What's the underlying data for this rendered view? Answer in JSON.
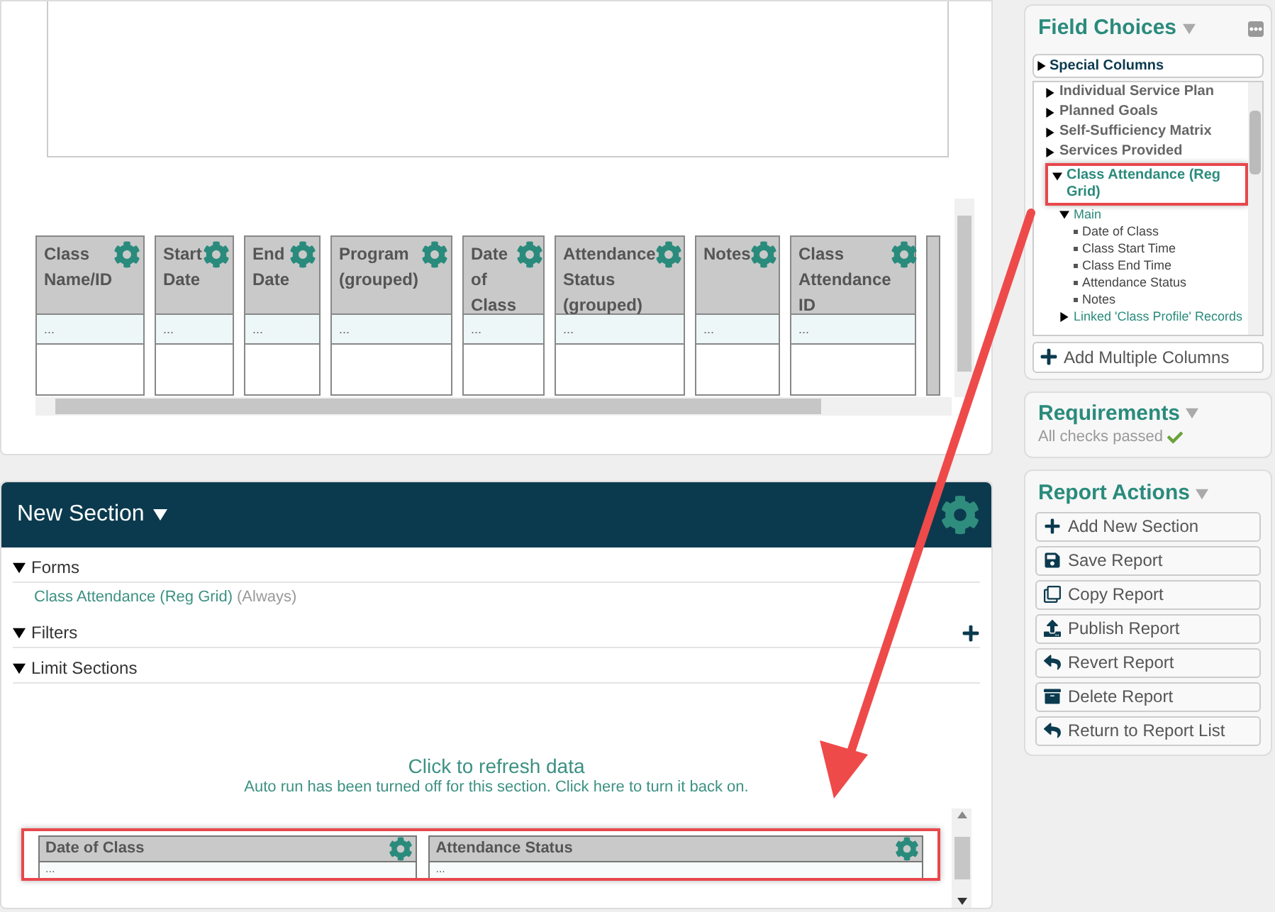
{
  "grid": {
    "columns": [
      {
        "label": "Class Name/ID",
        "cell": "..."
      },
      {
        "label": "Start Date",
        "cell": "..."
      },
      {
        "label": "End Date",
        "cell": "..."
      },
      {
        "label": "Program (grouped)",
        "cell": "..."
      },
      {
        "label": "Date of Class",
        "cell": "..."
      },
      {
        "label": "Attendance Status (grouped)",
        "cell": "..."
      },
      {
        "label": "Notes",
        "cell": "..."
      },
      {
        "label": "Class Attendance ID",
        "cell": "..."
      }
    ]
  },
  "section": {
    "title": "New Section",
    "groups": [
      {
        "label": "Forms",
        "expanded": true,
        "form": {
          "name": "Class Attendance (Reg Grid)",
          "condition": "(Always)"
        }
      },
      {
        "label": "Filters",
        "expanded": true,
        "add": true
      },
      {
        "label": "Limit Sections",
        "expanded": true
      }
    ],
    "refresh": {
      "title": "Click to refresh data",
      "note": "Auto run has been turned off for this section. Click here to turn it back on."
    },
    "columns": [
      {
        "label": "Date of Class",
        "cell": "..."
      },
      {
        "label": "Attendance Status",
        "cell": "..."
      }
    ]
  },
  "field_choices": {
    "title": "Field Choices",
    "special_columns": {
      "label": "Special Columns",
      "expanded": false
    },
    "tree": [
      {
        "label": "Individual Service Plan",
        "expanded": false
      },
      {
        "label": "Planned Goals",
        "expanded": false
      },
      {
        "label": "Self-Sufficiency Matrix",
        "expanded": false
      },
      {
        "label": "Services Provided",
        "expanded": false
      },
      {
        "label": "Class Attendance (Reg Grid)",
        "expanded": true,
        "highlighted": true,
        "children": [
          {
            "label": "Main",
            "expanded": true,
            "children": [
              {
                "label": "Date of Class"
              },
              {
                "label": "Class Start Time"
              },
              {
                "label": "Class End Time"
              },
              {
                "label": "Attendance Status"
              },
              {
                "label": "Notes"
              }
            ]
          },
          {
            "label": "Linked 'Class Profile' Records",
            "expanded": false
          }
        ]
      }
    ],
    "button": "Add Multiple Columns"
  },
  "requirements": {
    "title": "Requirements",
    "status": "All checks passed"
  },
  "report_actions": {
    "title": "Report Actions",
    "buttons": [
      {
        "kind": "add",
        "label": "Add New Section"
      },
      {
        "kind": "save",
        "label": "Save Report"
      },
      {
        "kind": "copy",
        "label": "Copy Report"
      },
      {
        "kind": "publish",
        "label": "Publish Report"
      },
      {
        "kind": "revert",
        "label": "Revert Report"
      },
      {
        "kind": "delete",
        "label": "Delete Report"
      },
      {
        "kind": "return",
        "label": "Return to Report List"
      }
    ]
  }
}
